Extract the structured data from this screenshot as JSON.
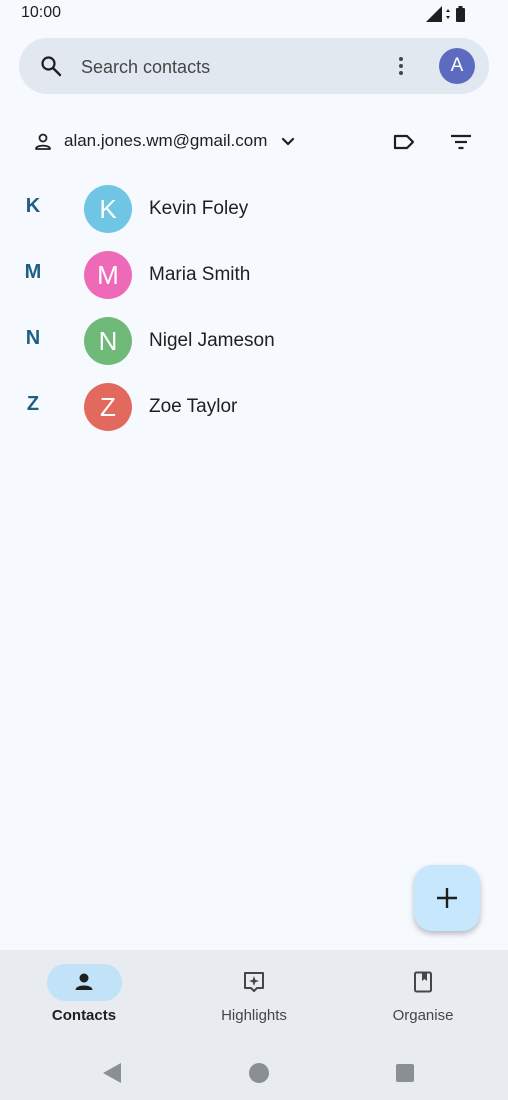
{
  "status_bar": {
    "time": "10:00"
  },
  "search": {
    "placeholder": "Search contacts"
  },
  "profile": {
    "initial": "A",
    "color": "#5c6bc0"
  },
  "account": {
    "email": "alan.jones.wm@gmail.com"
  },
  "contacts": [
    {
      "letter": "K",
      "initial": "K",
      "name": "Kevin Foley",
      "color": "#6ec6e4"
    },
    {
      "letter": "M",
      "initial": "M",
      "name": "Maria Smith",
      "color": "#ee69b7"
    },
    {
      "letter": "N",
      "initial": "N",
      "name": "Nigel Jameson",
      "color": "#6fba79"
    },
    {
      "letter": "Z",
      "initial": "Z",
      "name": "Zoe Taylor",
      "color": "#e1695e"
    }
  ],
  "bottom_nav": [
    {
      "label": "Contacts",
      "icon": "person-icon",
      "active": true
    },
    {
      "label": "Highlights",
      "icon": "highlights-icon",
      "active": false
    },
    {
      "label": "Organise",
      "icon": "organise-icon",
      "active": false
    }
  ],
  "icons": {
    "search": "search-icon",
    "more": "more-vert-icon",
    "add": "plus-icon",
    "back": "back-triangle-icon",
    "home": "home-circle-icon",
    "recents": "recents-square-icon"
  },
  "colors": {
    "background": "#f6f9fe",
    "search_bar": "#e1e8f0",
    "fab": "#c7e7fd",
    "nav_active_pill": "#c2e3f7",
    "section_letter": "#1f5f84"
  }
}
